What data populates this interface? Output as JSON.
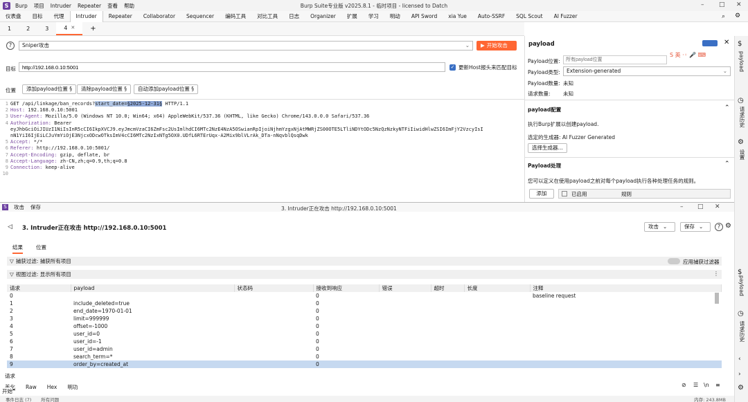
{
  "app": {
    "logo": "S",
    "menu": [
      "Burp",
      "项目",
      "Intruder",
      "Repeater",
      "查看",
      "帮助"
    ],
    "window_title": "Burp Suite专业版  v2025.8.1 - 临时项目 - licensed to Datch",
    "win_controls": [
      "–",
      "□",
      "✕"
    ]
  },
  "tool_tabs": [
    "仪表盘",
    "目标",
    "代理",
    "Intruder",
    "Repeater",
    "Collaborator",
    "Sequencer",
    "编码工具",
    "对比工具",
    "日志",
    "Organizer",
    "扩展",
    "学习",
    "明动",
    "API Sword",
    "xia Yue",
    "Auto-SSRF",
    "SQL Scout",
    "AI Fuzzer"
  ],
  "sub_tabs": [
    "1",
    "2",
    "3",
    "4"
  ],
  "sub_tab_close": "✕",
  "sub_tab_add": "+",
  "attack": {
    "type": "Sniper攻击",
    "start_label": "开始攻击",
    "target_label": "目标",
    "target_value": "http://192.168.0.10:5001",
    "update_host_label": "更新Host报头来匹配目标",
    "positions_label": "位置",
    "add_btn": "添加payload位置 §",
    "clear_btn": "清除payload位置 §",
    "auto_btn": "自动添加payload位置 §"
  },
  "request": {
    "line1_pre": "GET /api/linkage/ban_records?",
    "line1_param": "start_date=",
    "line1_value": "§2025-12-31§",
    "line1_post": " HTTP/1.1",
    "headers": [
      {
        "k": "Host:",
        "v": " 192.168.0.10:5001"
      },
      {
        "k": "User-Agent:",
        "v": " Mozilla/5.0 (Windows NT 10.0; Win64; x64) AppleWebKit/537.36 (KHTML, like Gecko) Chrome/143.0.0.0 Safari/537.36"
      },
      {
        "k": "Authorization:",
        "v": " Bearer"
      }
    ],
    "token1": "eyJhbGciOiJIUzI1NiIsInR5cCI6IkpXVCJ9.eyJmcmVzaCI6ZmFsc2UsImlhdCI6MTc2NzE4NzA5OSwianRpIjoiNjhmYzgxNjAtMWRjZS00OTE5LTliNDYtODc5NzQzNzkyNTFiIiwidHlwZSI6ImFjY2VzcyIsI",
    "token2": "nN1YiI6IjEiLCJuYmYiOjE3NjcxODcwOTksImV4cCI6MTc2NzIxNTg5OX0.UDfL6RTErUqx-A2Mix9blVLrAk_DTa-nNqvblQsqDwk",
    "headers2": [
      {
        "k": "Accept:",
        "v": " */*"
      },
      {
        "k": "Referer:",
        "v": " http://192.168.0.10:5001/"
      },
      {
        "k": "Accept-Encoding:",
        "v": " gzip, deflate, br"
      },
      {
        "k": "Accept-Language:",
        "v": " zh-CN,zh;q=0.9,th;q=0.8"
      },
      {
        "k": "Connection:",
        "v": " keep-alive"
      }
    ],
    "line_numbers": [
      "1",
      "2",
      "3",
      "4",
      "5",
      "6",
      "7",
      "8",
      "9",
      "10"
    ]
  },
  "payload_panel": {
    "title": "payload",
    "pos_label": "Payload位置:",
    "pos_placeholder": "所有payload位置",
    "type_label": "Payload类型:",
    "type_value": "Extension-generated",
    "count_label": "Payload数量:",
    "count_value": "未知",
    "req_label": "请求数量:",
    "req_value": "未知",
    "config_title": "payload配置",
    "config_desc": "执行Burp扩展以创建payload.",
    "gen_label": "选定的生成器: AI Fuzzer Generated",
    "gen_btn": "选择生成器...",
    "proc_title": "Payload处理",
    "proc_desc": "您可以定义在使用payload之前对每个payload执行各种处理任务的规则。",
    "add_btn": "添加",
    "col_enabled": "已启用",
    "col_rule": "规则"
  },
  "rail": {
    "payload_label": "payload",
    "history_label": "请求历史",
    "settings_label": "设置"
  },
  "attack_window": {
    "menu": [
      "攻击",
      "保存"
    ],
    "title": "3. Intruder正在攻击 http://192.168.0.10:5001",
    "heading": "3. Intruder正在攻击 http://192.168.0.10:5001",
    "attack_btn": "攻击",
    "save_btn": "保存",
    "tabs": [
      "结果",
      "位置"
    ],
    "capture_filter": "捕获过滤: 捕获所有项目",
    "apply_filter": "应用捕获过滤器",
    "view_filter": "视图过滤: 显示所有项目",
    "columns": [
      "请求",
      "payload",
      "状态码",
      "接收到响应",
      "错误",
      "超时",
      "长度",
      "注释"
    ],
    "rows": [
      {
        "req": "0",
        "payload": "",
        "resp": "0",
        "note": "baseline request"
      },
      {
        "req": "1",
        "payload": "include_deleted=true",
        "resp": "0",
        "note": ""
      },
      {
        "req": "2",
        "payload": "end_date=1970-01-01",
        "resp": "0",
        "note": ""
      },
      {
        "req": "3",
        "payload": "limit=999999",
        "resp": "0",
        "note": ""
      },
      {
        "req": "4",
        "payload": "offset=-1000",
        "resp": "0",
        "note": ""
      },
      {
        "req": "5",
        "payload": "user_id=0",
        "resp": "0",
        "note": ""
      },
      {
        "req": "6",
        "payload": "user_id=-1",
        "resp": "0",
        "note": ""
      },
      {
        "req": "7",
        "payload": "user_id=admin",
        "resp": "0",
        "note": ""
      },
      {
        "req": "8",
        "payload": "search_term=*",
        "resp": "0",
        "note": ""
      },
      {
        "req": "9",
        "payload": "order_by=created_at",
        "resp": "0",
        "note": ""
      }
    ],
    "request_label": "请求",
    "view_tabs": [
      "美化",
      "Raw",
      "Hex",
      "明功"
    ],
    "start_label": "开始"
  },
  "status_bar": {
    "event_log": "事件日志 (7)",
    "issues": "所有问题",
    "memory": "内存: 243.8MB"
  },
  "colors": {
    "accent": "#ff6633",
    "logo": "#6b3fa0",
    "selected_row": "#c6d9f0"
  }
}
